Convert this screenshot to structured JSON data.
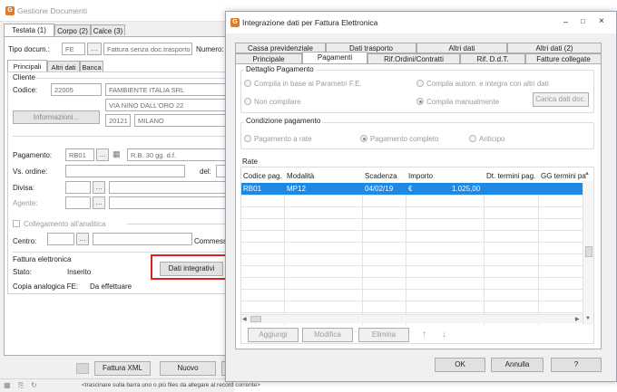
{
  "main": {
    "title": "Gestione Documenti",
    "tabs": [
      "Testata (1)",
      "Corpo (2)",
      "Calce (3)"
    ],
    "tipo_label": "Tipo docum.:",
    "tipo_code": "FE",
    "tipo_desc": "Fattura senza doc.trasporto",
    "numero_label": "Numero:",
    "subtabs": [
      "Principali",
      "Altri dati",
      "Banca"
    ],
    "cliente_label": "Cliente",
    "codice_label": "Codice:",
    "codice": "22005",
    "ragione_sociale": "FAMBIENTE ITALIA SRL",
    "indirizzo": "VIA NINO DALL'ORO 22",
    "informazioni": "Informazioni...",
    "cap": "20121",
    "citta": "MILANO",
    "pagamento_label": "Pagamento:",
    "pagamento_code": "RB01",
    "pagamento_desc": "R.B. 30 gg. d.f.",
    "vs_ordine_label": "Vs. ordine:",
    "del_label": "del:",
    "divisa_label": "Divisa:",
    "agente_label": "Agente:",
    "collegamento_label": "Collegamento all'analitica",
    "centro_label": "Centro:",
    "commessa_label": "Commess",
    "fattura_el_label": "Fattura elettronica",
    "stato_label": "Stato:",
    "stato_value": "Inserito",
    "dati_integrativi": "Dati integrativi",
    "copia_label": "Copia analogica FE:",
    "copia_value": "Da effettuare",
    "fattura_xml": "Fattura XML",
    "nuovo": "Nuovo",
    "status_hint": "<trascinare sulla barra uno o più files da allegare al record corrente>"
  },
  "dialog": {
    "title": "Integrazione dati per Fattura Elettronica",
    "tabs_row1": [
      "Cassa previdenziale",
      "Dati trasporto",
      "Altri dati",
      "Altri dati (2)"
    ],
    "tabs_row2": [
      "Principale",
      "Pagamenti",
      "Rif.Ordini/Contratti",
      "Rif. D.d.T.",
      "Fatture collegate"
    ],
    "active_tab": "Pagamenti",
    "dettaglio_title": "Dettaglio Pagamento",
    "radio_params": "Compila in base ai Parametri F.E.",
    "radio_auto": "Compila autom. e integra con altri dati",
    "radio_non": "Non compilare",
    "radio_manual": "Compila manualmente",
    "carica_btn": "Carica dati doc.",
    "condizione_title": "Condizione pagamento",
    "cond_rate": "Pagamento a rate",
    "cond_completo": "Pagamento completo",
    "cond_anticipo": "Anticipo",
    "rate_title": "Rate",
    "columns": [
      "Codice pag.",
      "Modalità",
      "Scadenza",
      "Importo",
      "Dt. termini pag.",
      "GG termini pa"
    ],
    "row": {
      "codice": "RB01",
      "modalita": "MP12",
      "scadenza": "04/02/19",
      "valuta": "€",
      "importo": "1.025,00"
    },
    "aggiungi": "Aggiungi",
    "modifica": "Modifica",
    "elimina": "Elimina",
    "ok": "OK",
    "annulla": "Annulla",
    "help": "?"
  }
}
